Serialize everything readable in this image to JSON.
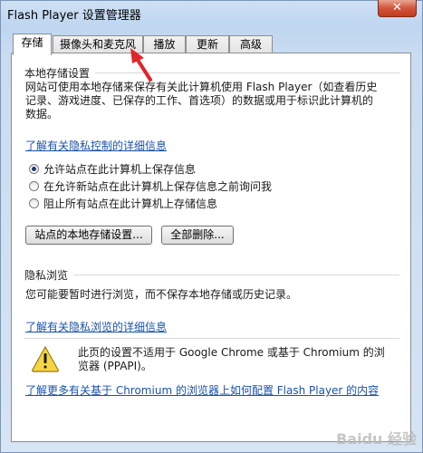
{
  "window": {
    "title": "Flash Player 设置管理器"
  },
  "tabs": [
    "存储",
    "摄像头和麦克风",
    "播放",
    "更新",
    "高级"
  ],
  "storage": {
    "section_title": "本地存储设置",
    "description": "网站可使用本地存储来保存有关此计算机使用 Flash Player（如查看历史记录、游戏进度、已保存的工作、首选项）的数据或用于标识此计算机的数据。",
    "privacy_link": "了解有关隐私控制的详细信息",
    "options": [
      "允许站点在此计算机上保存信息",
      "在允许新站点在此计算机上保存信息之前询问我",
      "阻止所有站点在此计算机上存储信息"
    ],
    "selected_option": 0,
    "site_settings_button": "站点的本地存储设置...",
    "delete_all_button": "全部删除..."
  },
  "private_browsing": {
    "section_title": "隐私浏览",
    "description": "您可能要暂时进行浏览，而不保存本地存储或历史记录。",
    "link": "了解有关隐私浏览的详细信息"
  },
  "notice": {
    "icon": "warning-icon",
    "text": "此页的设置不适用于 Google Chrome 或基于 Chromium 的浏览器 (PPAPI)。",
    "link": "了解更多有关基于 Chromium 的浏览器上如何配置 Flash Player 的内容"
  },
  "watermark": "Baidu 经验",
  "colors": {
    "link": "#1a52a8",
    "annotation_arrow": "#e0262b"
  }
}
